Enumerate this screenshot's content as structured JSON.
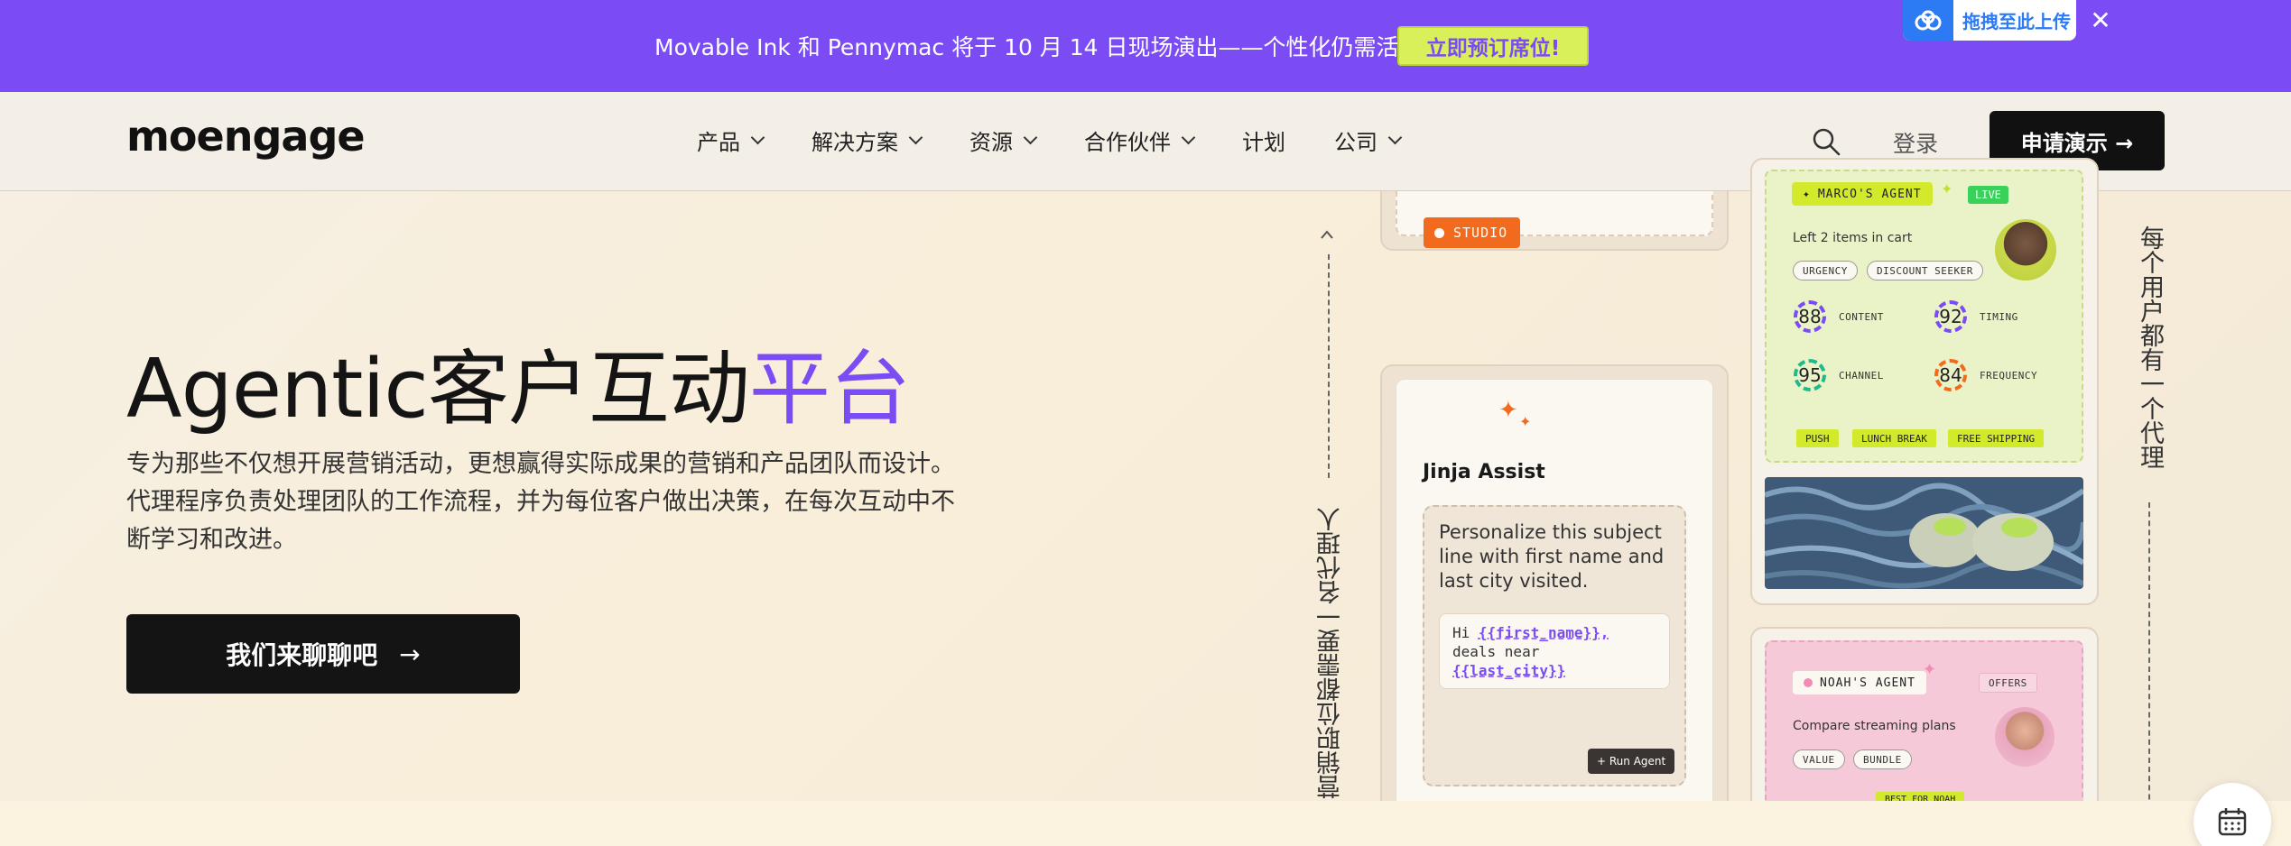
{
  "banner": {
    "text": "Movable Ink 和 Pennymac 将于 10 月 14 日现场演出——个性化仍需活力。",
    "cta_label": "立即预订席位!",
    "upload_label": "拖拽至此上传",
    "close_glyph": "✕"
  },
  "header": {
    "logo": "moengage",
    "nav": [
      {
        "label": "产品",
        "has_dropdown": true
      },
      {
        "label": "解决方案",
        "has_dropdown": true
      },
      {
        "label": "资源",
        "has_dropdown": true
      },
      {
        "label": "合作伙伴",
        "has_dropdown": true
      },
      {
        "label": "计划",
        "has_dropdown": false
      },
      {
        "label": "公司",
        "has_dropdown": true
      }
    ],
    "login_label": "登录",
    "demo_label": "申请演示 →"
  },
  "hero": {
    "title_main": "Agentic客户互动",
    "title_accent": "平台",
    "description": "专为那些不仅想开展营销活动，更想赢得实际成果的营销和产品团队而设计。代理程序负责处理团队的工作流程，并为每位客户做出决策，在每次互动中不断学习和改进。",
    "cta_label": "我们来聊聊吧",
    "cta_arrow": "→",
    "side_label_left": "营销职位都需要一名代理人",
    "side_label_right": "每个用户都有一个代理",
    "accent_color": "#7b4cf4"
  },
  "studio_card": {
    "badge": "STUDIO",
    "title": "Jinja Assist",
    "prompt": "Personalize this subject line with first name and last city visited.",
    "code_prefix": "Hi ",
    "code_var1": "{{first_name}},",
    "code_mid": "deals near",
    "code_var2": "{{last_city}}",
    "run_label": "+ Run Agent"
  },
  "marco_card": {
    "badge": "MARCO'S AGENT",
    "live": "LIVE",
    "status": "Left 2 items in cart",
    "pills": [
      "URGENCY",
      "DISCOUNT SEEKER"
    ],
    "scores": [
      {
        "value": "88",
        "label": "CONTENT",
        "color": "#7b4cf4"
      },
      {
        "value": "92",
        "label": "TIMING",
        "color": "#7b4cf4"
      },
      {
        "value": "95",
        "label": "CHANNEL",
        "color": "#1fb98a"
      },
      {
        "value": "84",
        "label": "FREQUENCY",
        "color": "#f16a1d"
      }
    ],
    "tags": [
      "PUSH",
      "LUNCH BREAK",
      "FREE SHIPPING"
    ]
  },
  "noah_card": {
    "badge": "NOAH'S AGENT",
    "offers": "OFFERS",
    "status": "Compare streaming plans",
    "pills": [
      "VALUE",
      "BUNDLE"
    ],
    "best_for": "BEST FOR NOAH"
  }
}
